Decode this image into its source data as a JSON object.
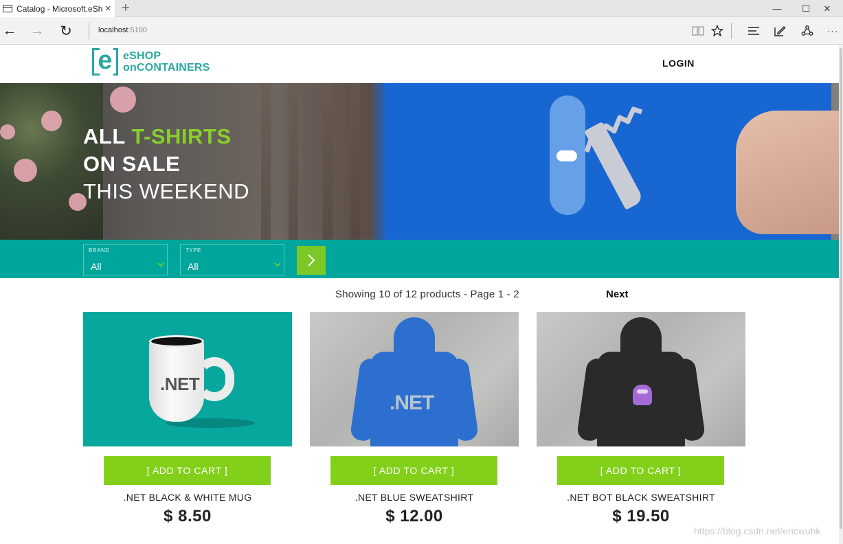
{
  "browser": {
    "tab_title": "Catalog - Microsoft.eSh",
    "tab_close": "×",
    "new_tab": "+",
    "url_host": "localhost",
    "url_port": ":5100",
    "window_controls": {
      "minimize": "—",
      "maximize": "☐",
      "close": "✕"
    },
    "nav": {
      "back": "←",
      "forward": "→",
      "refresh": "↻"
    },
    "toolbar_icons": [
      "reading-view-icon",
      "favorite-star-icon",
      "hub-icon",
      "web-note-icon",
      "share-icon",
      "more-icon"
    ],
    "more_label": "···"
  },
  "header": {
    "logo_letter": "e",
    "logo_line1": "eSHOP",
    "logo_line2": "onCONTAINERS",
    "login_label": "LOGIN"
  },
  "hero": {
    "line1_a": "ALL ",
    "line1_b": "T-SHIRTS",
    "line2": "ON SALE",
    "line3": "THIS WEEKEND"
  },
  "filters": {
    "brand_label": "BRAND",
    "brand_value": "All",
    "type_label": "TYPE",
    "type_value": "All",
    "apply_icon": "chevron-right-icon"
  },
  "pager": {
    "info": "Showing 10 of 12 products - Page 1 - 2",
    "next": "Next"
  },
  "products": [
    {
      "name": ".NET BLACK & WHITE MUG",
      "price": "$ 8.50",
      "button": "[ ADD TO CART ]",
      "image_text": ".NET"
    },
    {
      "name": ".NET BLUE SWEATSHIRT",
      "price": "$ 12.00",
      "button": "[ ADD TO CART ]",
      "image_text": ".NET"
    },
    {
      "name": ".NET BOT BLACK SWEATSHIRT",
      "price": "$ 19.50",
      "button": "[ ADD TO CART ]",
      "image_text": ""
    }
  ],
  "watermark": "https://blog.csdn.net/ericwuhk",
  "colors": {
    "brand_teal": "#00a69c",
    "accent_green": "#83d01b"
  }
}
